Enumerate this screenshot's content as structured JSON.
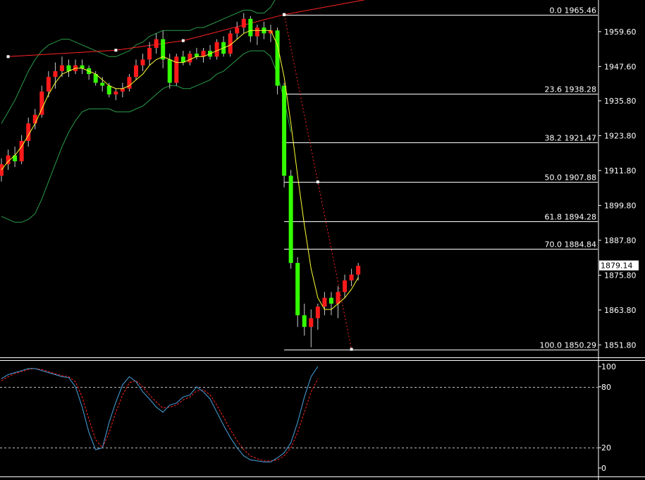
{
  "colors": {
    "background": "#000000",
    "bull": "#ff1a1a",
    "bear": "#33ff00",
    "wick": "#cccccc",
    "band": "#2a9d4a",
    "ma": "#ffff33",
    "trendline": "#ff2222",
    "fib": "#ffffff",
    "stoch_main": "#4aa3df",
    "stoch_signal": "#ff2222",
    "axis_text": "#ffffff",
    "price_box_bg": "#ffffff",
    "price_box_text": "#000000"
  },
  "chart_data": [
    {
      "type": "candlestick",
      "y_ticks": [
        "1959.60",
        "1947.60",
        "1935.80",
        "1923.80",
        "1911.80",
        "1899.80",
        "1887.80",
        "1875.80",
        "1863.80",
        "1851.80"
      ],
      "ylim": [
        1848.0,
        1970.0
      ],
      "current_price": "1879.14",
      "candles": [
        [
          1910,
          1916,
          1908,
          1914
        ],
        [
          1914,
          1919,
          1912,
          1917
        ],
        [
          1917,
          1920,
          1913,
          1915
        ],
        [
          1915,
          1924,
          1914,
          1922
        ],
        [
          1922,
          1930,
          1920,
          1928
        ],
        [
          1928,
          1933,
          1926,
          1931
        ],
        [
          1931,
          1941,
          1930,
          1939
        ],
        [
          1939,
          1946,
          1937,
          1944
        ],
        [
          1944,
          1949,
          1940,
          1946
        ],
        [
          1946,
          1951,
          1944,
          1948
        ],
        [
          1948,
          1950,
          1944,
          1946
        ],
        [
          1946,
          1950,
          1945,
          1948
        ],
        [
          1948,
          1950,
          1945,
          1947
        ],
        [
          1947,
          1948,
          1943,
          1945
        ],
        [
          1945,
          1946,
          1941,
          1942
        ],
        [
          1942,
          1944,
          1939,
          1941
        ],
        [
          1941,
          1942,
          1937,
          1938
        ],
        [
          1938,
          1940,
          1936,
          1939
        ],
        [
          1939,
          1942,
          1937,
          1940
        ],
        [
          1940,
          1945,
          1939,
          1944
        ],
        [
          1944,
          1950,
          1943,
          1948
        ],
        [
          1948,
          1952,
          1946,
          1950
        ],
        [
          1950,
          1956,
          1948,
          1954
        ],
        [
          1954,
          1959,
          1952,
          1957
        ],
        [
          1957,
          1960,
          1947,
          1950
        ],
        [
          1950,
          1952,
          1940,
          1942
        ],
        [
          1942,
          1952,
          1941,
          1951
        ],
        [
          1951,
          1953,
          1948,
          1949
        ],
        [
          1949,
          1953,
          1948,
          1952
        ],
        [
          1952,
          1954,
          1950,
          1951
        ],
        [
          1951,
          1954,
          1949,
          1953
        ],
        [
          1953,
          1955,
          1950,
          1951
        ],
        [
          1951,
          1957,
          1950,
          1956
        ],
        [
          1956,
          1958,
          1951,
          1952
        ],
        [
          1952,
          1960,
          1951,
          1959
        ],
        [
          1959,
          1963,
          1957,
          1961
        ],
        [
          1961,
          1966,
          1959,
          1964
        ],
        [
          1964,
          1965,
          1956,
          1958
        ],
        [
          1958,
          1962,
          1955,
          1961
        ],
        [
          1961,
          1963,
          1957,
          1959
        ],
        [
          1959,
          1962,
          1956,
          1960
        ],
        [
          1960,
          1961,
          1938,
          1941
        ],
        [
          1941,
          1942,
          1906,
          1910
        ],
        [
          1910,
          1912,
          1878,
          1880
        ],
        [
          1880,
          1882,
          1858,
          1862
        ],
        [
          1862,
          1866,
          1855,
          1858
        ],
        [
          1858,
          1864,
          1851,
          1861
        ],
        [
          1861,
          1866,
          1857,
          1865
        ],
        [
          1865,
          1870,
          1862,
          1868
        ],
        [
          1868,
          1870,
          1862,
          1866
        ],
        [
          1866,
          1872,
          1861,
          1870
        ],
        [
          1870,
          1876,
          1868,
          1874
        ],
        [
          1874,
          1878,
          1872,
          1876
        ],
        [
          1876,
          1880,
          1874,
          1879
        ]
      ],
      "ma": [
        1912,
        1915,
        1917,
        1920,
        1924,
        1928,
        1933,
        1938,
        1942,
        1945,
        1946,
        1947,
        1947,
        1946,
        1945,
        1943,
        1941,
        1940,
        1940,
        1941,
        1943,
        1945,
        1948,
        1950,
        1951,
        1950,
        1949,
        1949,
        1950,
        1951,
        1951,
        1952,
        1953,
        1954,
        1955,
        1957,
        1959,
        1960,
        1960,
        1960,
        1960,
        1955,
        1944,
        1928,
        1910,
        1893,
        1878,
        1868,
        1864,
        1864,
        1866,
        1868,
        1871,
        1875
      ],
      "bb_upper": [
        1928,
        1932,
        1936,
        1941,
        1946,
        1950,
        1953,
        1955,
        1956,
        1957,
        1957,
        1956,
        1955,
        1954,
        1953,
        1952,
        1951,
        1951,
        1952,
        1953,
        1955,
        1956,
        1958,
        1959,
        1960,
        1960,
        1960,
        1960,
        1960,
        1961,
        1961,
        1962,
        1963,
        1964,
        1965,
        1966,
        1967,
        1967,
        1966,
        1966,
        1968,
        1972,
        1978
      ],
      "bb_lower": [
        1896,
        1895,
        1894,
        1894,
        1895,
        1897,
        1902,
        1908,
        1914,
        1920,
        1925,
        1929,
        1932,
        1933,
        1933,
        1933,
        1933,
        1932,
        1932,
        1932,
        1933,
        1934,
        1936,
        1938,
        1940,
        1941,
        1941,
        1940,
        1940,
        1941,
        1942,
        1943,
        1945,
        1946,
        1948,
        1950,
        1952,
        1953,
        1953,
        1953,
        1951,
        1945,
        1936,
        1925
      ],
      "trendline": {
        "points": [
          [
            1,
            1951
          ],
          [
            17,
            1953.2
          ],
          [
            27,
            1956.5
          ],
          [
            42,
            1965.46
          ],
          [
            55,
            1971
          ]
        ],
        "markers": [
          1,
          17,
          27,
          42
        ]
      },
      "zigzag": {
        "points": [
          [
            42,
            1965.46
          ],
          [
            47,
            1907.88
          ],
          [
            52,
            1850.29
          ]
        ],
        "markers": [
          42,
          47,
          52
        ]
      },
      "fibonacci": [
        {
          "level": "0.0",
          "price": "1965.46"
        },
        {
          "level": "23.6",
          "price": "1938.28"
        },
        {
          "level": "38.2",
          "price": "1921.47"
        },
        {
          "level": "50.0",
          "price": "1907.88"
        },
        {
          "level": "61.8",
          "price": "1894.28"
        },
        {
          "level": "70.0",
          "price": "1884.84"
        },
        {
          "level": "100.0",
          "price": "1850.29"
        }
      ]
    },
    {
      "type": "line",
      "indicator": "stochastic",
      "ylim": [
        0,
        100
      ],
      "y_ticks": [
        "100",
        "80",
        "20",
        "0"
      ],
      "levels": [
        80,
        20
      ],
      "main": [
        88,
        92,
        94,
        96,
        98,
        98,
        96,
        94,
        92,
        90,
        89,
        80,
        60,
        35,
        18,
        20,
        45,
        65,
        82,
        90,
        85,
        75,
        68,
        60,
        55,
        62,
        64,
        70,
        72,
        80,
        75,
        68,
        55,
        42,
        30,
        20,
        12,
        8,
        7,
        6,
        6,
        10,
        15,
        25,
        45,
        70,
        90,
        100
      ],
      "signal": [
        86,
        90,
        93,
        95,
        97,
        98,
        97,
        95,
        93,
        91,
        90,
        85,
        70,
        48,
        28,
        20,
        35,
        55,
        72,
        84,
        86,
        80,
        72,
        65,
        59,
        60,
        62,
        67,
        70,
        76,
        77,
        72,
        62,
        50,
        38,
        27,
        18,
        12,
        9,
        7,
        7,
        8,
        12,
        20,
        35,
        55,
        75,
        88
      ]
    }
  ]
}
